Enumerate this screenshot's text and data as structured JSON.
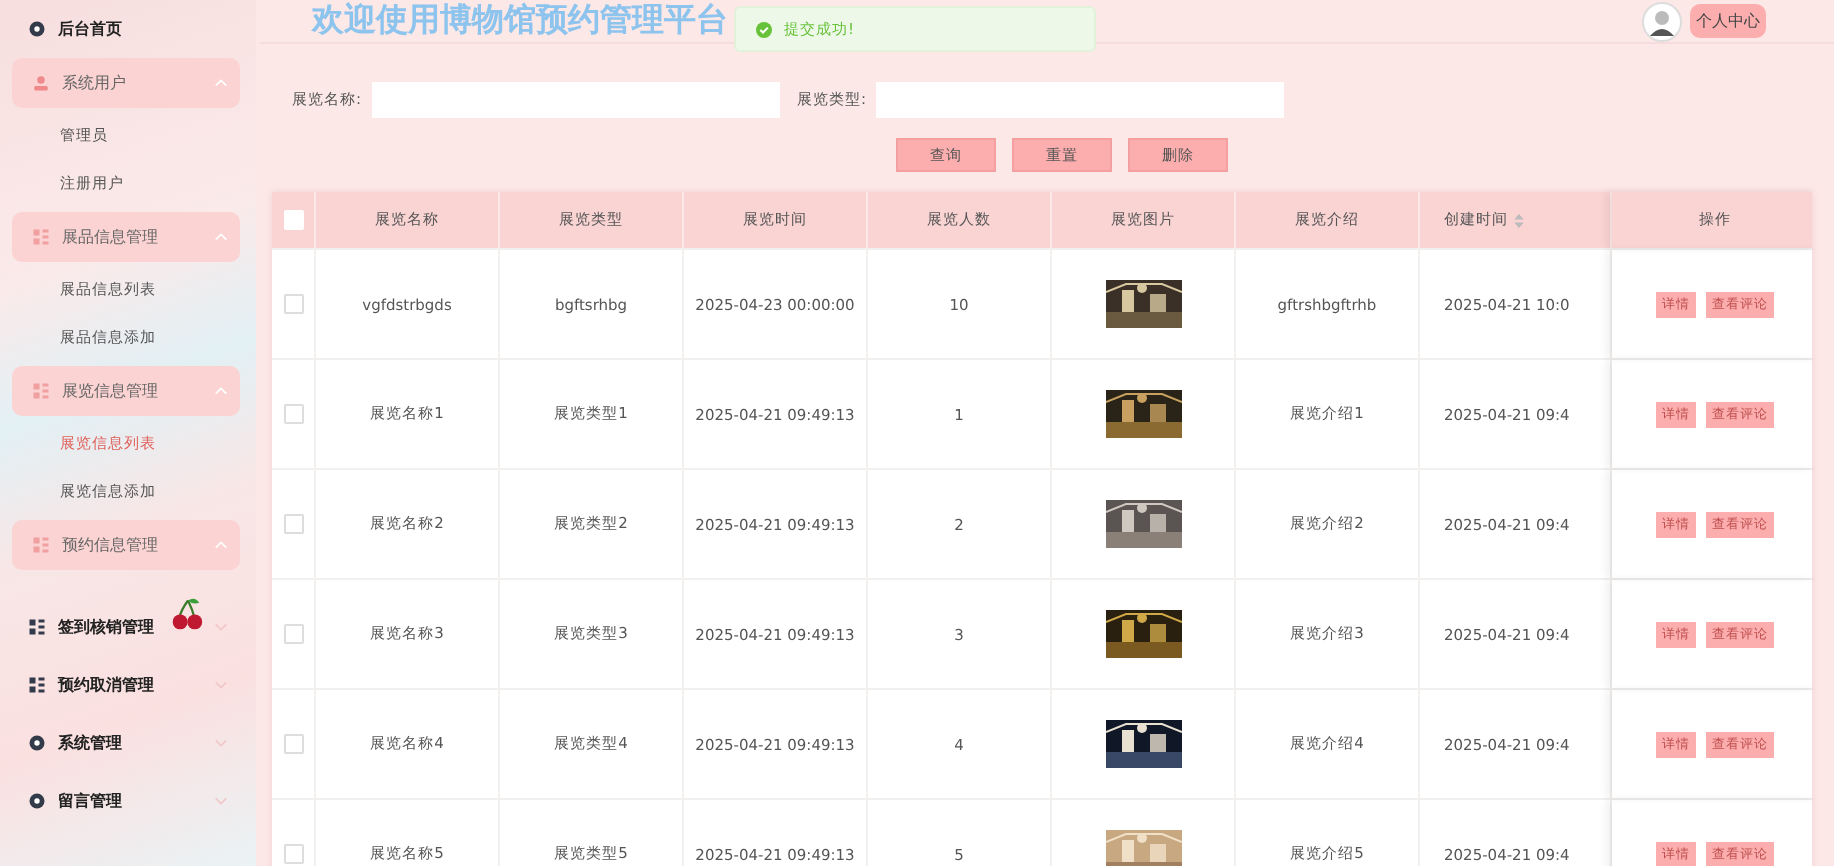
{
  "sidebar": {
    "items": [
      {
        "label": "后台首页",
        "kind": "link"
      },
      {
        "label": "系统用户",
        "kind": "group",
        "expanded": true,
        "children": [
          {
            "label": "管理员",
            "selected": false
          },
          {
            "label": "注册用户",
            "selected": false
          }
        ]
      },
      {
        "label": "展品信息管理",
        "kind": "group",
        "expanded": true,
        "children": [
          {
            "label": "展品信息列表",
            "selected": false
          },
          {
            "label": "展品信息添加",
            "selected": false
          }
        ]
      },
      {
        "label": "展览信息管理",
        "kind": "group",
        "expanded": true,
        "children": [
          {
            "label": "展览信息列表",
            "selected": true
          },
          {
            "label": "展览信息添加",
            "selected": false
          }
        ]
      },
      {
        "label": "预约信息管理",
        "kind": "group",
        "expanded": true
      },
      {
        "label": "签到核销管理",
        "kind": "plain",
        "expanded": false
      },
      {
        "label": "预约取消管理",
        "kind": "plain",
        "expanded": false
      },
      {
        "label": "系统管理",
        "kind": "plain",
        "expanded": false
      },
      {
        "label": "留言管理",
        "kind": "plain",
        "expanded": false
      }
    ]
  },
  "header": {
    "title": "欢迎使用博物馆预约管理平台",
    "toast": "提交成功!",
    "profile_button": "个人中心"
  },
  "search": {
    "fields": [
      {
        "label": "展览名称:"
      },
      {
        "label": "展览类型:"
      }
    ],
    "buttons": [
      "查询",
      "重置",
      "删除"
    ]
  },
  "table": {
    "columns": [
      "展览名称",
      "展览类型",
      "展览时间",
      "展览人数",
      "展览图片",
      "展览介绍",
      "创建时间",
      "操作"
    ],
    "select_all": false,
    "rows": [
      {
        "selected": false,
        "name": "vgfdstrbgds",
        "type": "bgftsrhbg",
        "time": "2025-04-23 00:00:00",
        "count": "10",
        "picture": {
          "kind": "picture"
        },
        "intro": "gftrshbgftrhb",
        "created": "2025-04-21 10:0",
        "actions": [
          "详情",
          "查看评论"
        ]
      },
      {
        "selected": false,
        "name": "展览名称1",
        "type": "展览类型1",
        "time": "2025-04-21 09:49:13",
        "count": "1",
        "picture": {
          "kind": "picture"
        },
        "intro": "展览介绍1",
        "created": "2025-04-21 09:4",
        "actions": [
          "详情",
          "查看评论"
        ]
      },
      {
        "selected": false,
        "name": "展览名称2",
        "type": "展览类型2",
        "time": "2025-04-21 09:49:13",
        "count": "2",
        "picture": {
          "kind": "picture"
        },
        "intro": "展览介绍2",
        "created": "2025-04-21 09:4",
        "actions": [
          "详情",
          "查看评论"
        ]
      },
      {
        "selected": false,
        "name": "展览名称3",
        "type": "展览类型3",
        "time": "2025-04-21 09:49:13",
        "count": "3",
        "picture": {
          "kind": "picture"
        },
        "intro": "展览介绍3",
        "created": "2025-04-21 09:4",
        "actions": [
          "详情",
          "查看评论"
        ]
      },
      {
        "selected": false,
        "name": "展览名称4",
        "type": "展览类型4",
        "time": "2025-04-21 09:49:13",
        "count": "4",
        "picture": {
          "kind": "picture"
        },
        "intro": "展览介绍4",
        "created": "2025-04-21 09:4",
        "actions": [
          "详情",
          "查看评论"
        ]
      },
      {
        "selected": false,
        "name": "展览名称5",
        "type": "展览类型5",
        "time": "2025-04-21 09:49:13",
        "count": "5",
        "picture": {
          "kind": "picture"
        },
        "intro": "展览介绍5",
        "created": "2025-04-21 09:4",
        "actions": [
          "详情",
          "查看评论"
        ]
      }
    ]
  }
}
